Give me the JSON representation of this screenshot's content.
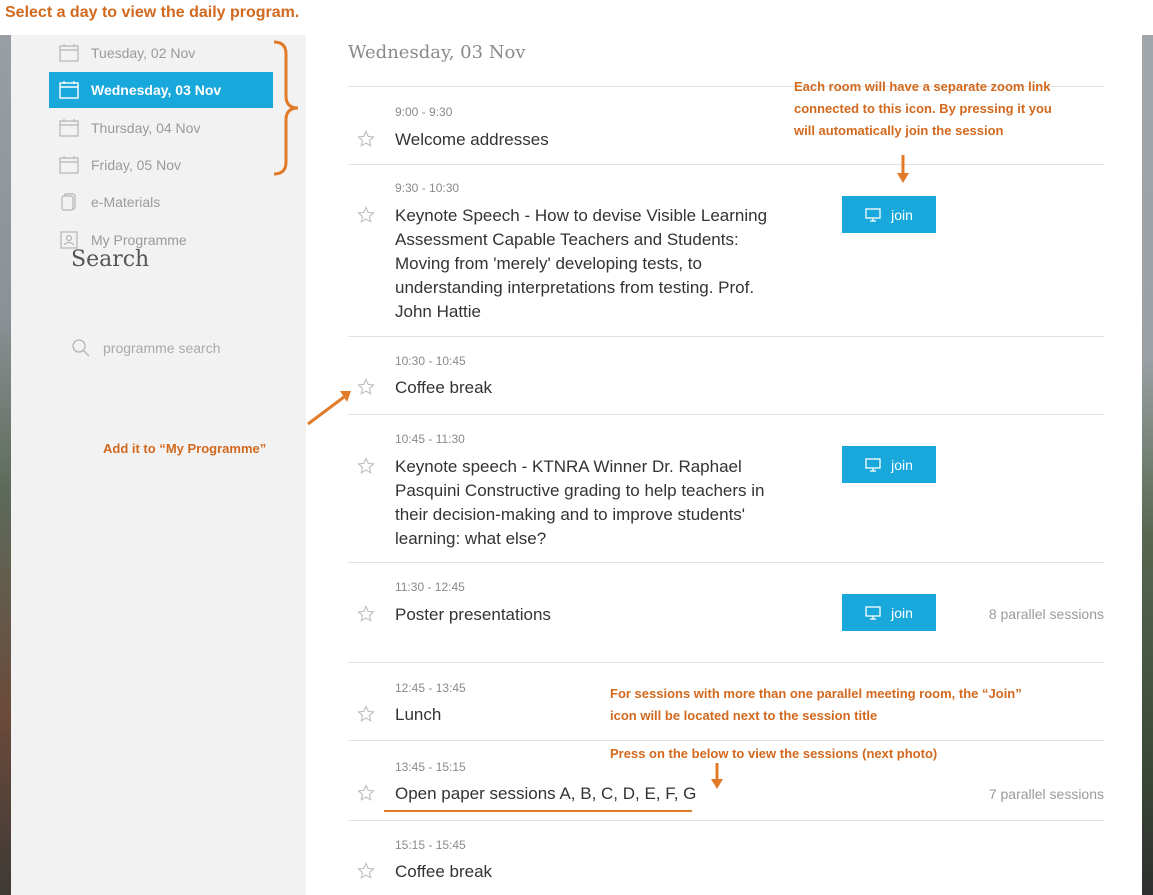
{
  "instruction": "Select  a day to view the daily program.",
  "sidebar": {
    "days": [
      {
        "label": "Tuesday, 02 Nov",
        "active": false
      },
      {
        "label": "Wednesday, 03 Nov",
        "active": true
      },
      {
        "label": "Thursday, 04 Nov",
        "active": false
      },
      {
        "label": "Friday, 05 Nov",
        "active": false
      }
    ],
    "materials": "e-Materials",
    "my_programme": "My Programme",
    "search_title": "Search",
    "search_placeholder": "programme search"
  },
  "main": {
    "day_title": "Wednesday, 03 Nov",
    "sessions": [
      {
        "time": "9:00 - 9:30",
        "title": "Welcome addresses"
      },
      {
        "time": "9:30 - 10:30",
        "title": "Keynote Speech - How to devise Visible Learning Assessment Capable Teachers and Students: Moving from 'merely' developing tests, to understanding interpretations from testing. Prof. John Hattie",
        "join": "join"
      },
      {
        "time": "10:30 - 10:45",
        "title": "Coffee break"
      },
      {
        "time": "10:45 - 11:30",
        "title": "Keynote speech - KTNRA Winner Dr. Raphael Pasquini Constructive grading to help teachers in their decision-making and to improve students' learning: what else?",
        "join": "join"
      },
      {
        "time": "11:30 - 12:45",
        "title": "Poster presentations",
        "join": "join",
        "parallel": "8 parallel sessions"
      },
      {
        "time": "12:45 - 13:45",
        "title": "Lunch"
      },
      {
        "time": "13:45 - 15:15",
        "title": "Open paper sessions A, B, C, D, E, F, G",
        "parallel": "7 parallel sessions"
      },
      {
        "time": "15:15 - 15:45",
        "title": "Coffee break"
      }
    ]
  },
  "annotations": {
    "zoom_line1": "Each room will have a separate zoom link",
    "zoom_line2": "connected to this icon. By pressing it you",
    "zoom_line3": "will automatically join the session",
    "add_it": "Add it to “My Programme”",
    "parallel_line1": "For sessions with more than one parallel meeting room, the “Join”",
    "parallel_line2": "icon will be located next to the session title",
    "press_below": "Press on the below to view the sessions (next photo)"
  },
  "colors": {
    "accent": "#19a8dc",
    "annotation": "#d2691e",
    "sidebar_bg": "#f2f2f2"
  },
  "icons": {
    "day": "calendar-icon",
    "materials": "document-icon",
    "my_programme": "person-icon",
    "search": "search-icon",
    "favorite": "star-outline-icon",
    "join": "monitor-icon"
  }
}
